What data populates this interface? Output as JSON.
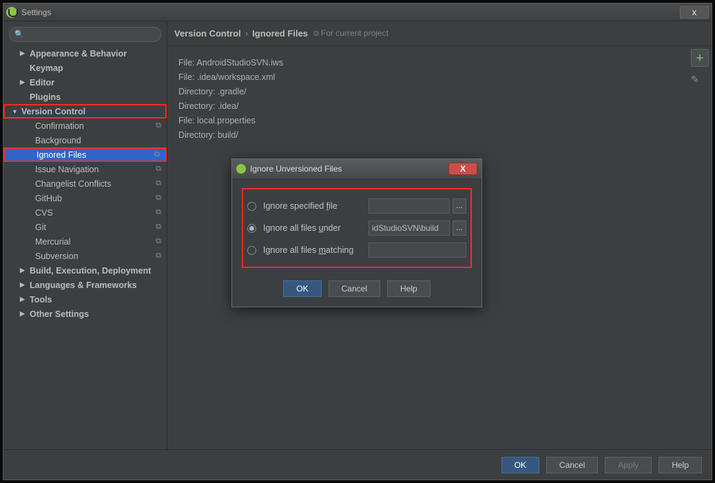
{
  "window": {
    "title": "Settings",
    "close": "x"
  },
  "search": {
    "placeholder": "",
    "icon": "🔍"
  },
  "tree": {
    "appearance": "Appearance & Behavior",
    "keymap": "Keymap",
    "editor": "Editor",
    "plugins": "Plugins",
    "vc": "Version Control",
    "vc_items": {
      "confirmation": "Confirmation",
      "background": "Background",
      "ignored": "Ignored Files",
      "issuenav": "Issue Navigation",
      "changelist": "Changelist Conflicts",
      "github": "GitHub",
      "cvs": "CVS",
      "git": "Git",
      "mercurial": "Mercurial",
      "subversion": "Subversion"
    },
    "build": "Build, Execution, Deployment",
    "lang": "Languages & Frameworks",
    "tools": "Tools",
    "other": "Other Settings"
  },
  "breadcrumb": {
    "a": "Version Control",
    "b": "Ignored Files",
    "proj": "For current project"
  },
  "ignored_list": [
    "File: AndroidStudioSVN.iws",
    "File: .idea/workspace.xml",
    "Directory: .gradle/",
    "Directory: .idea/",
    "File: local.properties",
    "Directory: build/"
  ],
  "toolbar": {
    "add": "+",
    "edit": "✎"
  },
  "footer": {
    "ok": "OK",
    "cancel": "Cancel",
    "apply": "Apply",
    "help": "Help"
  },
  "modal": {
    "title": "Ignore Unversioned Files",
    "close": "X",
    "opt1": "Ignore specified ",
    "opt1_u": "f",
    "opt1_rest": "ile",
    "opt2": "Ignore all files ",
    "opt2_u": "u",
    "opt2_rest": "nder",
    "opt3": "Ignore all files ",
    "opt3_u": "m",
    "opt3_rest": "atching",
    "val2": "idStudioSVN\\build",
    "ok": "OK",
    "cancel": "Cancel",
    "help": "Help"
  }
}
